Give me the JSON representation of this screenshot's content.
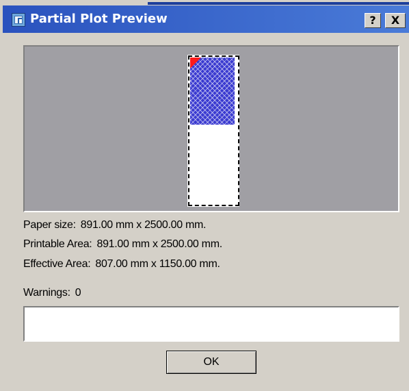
{
  "window": {
    "title": "Partial Plot Preview",
    "help_label": "?",
    "close_label": "X"
  },
  "info": {
    "paper_size_label": "Paper size:",
    "paper_size_value": "891.00 mm x 2500.00 mm.",
    "printable_area_label": "Printable Area:",
    "printable_area_value": "891.00 mm x 2500.00 mm.",
    "effective_area_label": "Effective Area:",
    "effective_area_value": "807.00 mm x 1150.00 mm."
  },
  "warnings": {
    "label": "Warnings:",
    "count": "0",
    "text": ""
  },
  "buttons": {
    "ok_label": "OK"
  },
  "colors": {
    "titlebar": "#2a52be",
    "preview_background": "#a09fa4",
    "plot_area": "#3a3ad0",
    "origin_marker": "#ff1a1a"
  }
}
